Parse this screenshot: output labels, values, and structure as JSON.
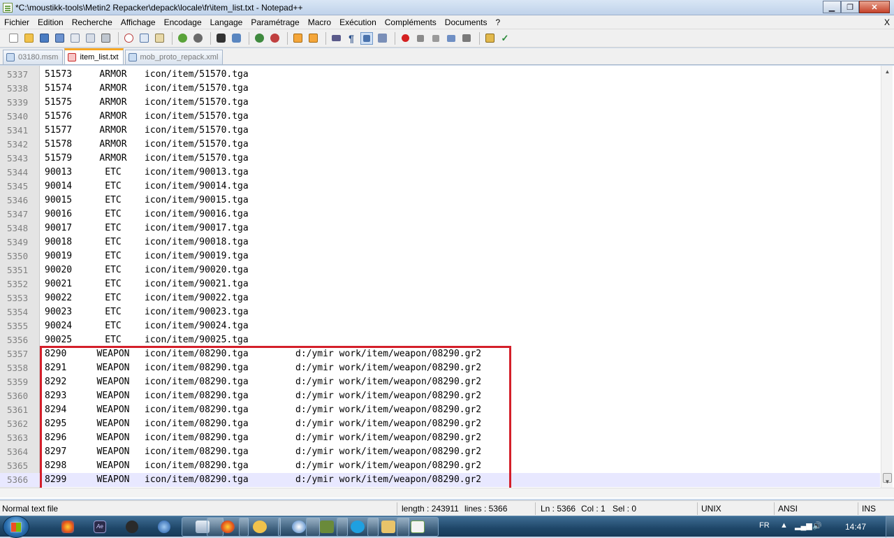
{
  "window": {
    "title": "*C:\\moustikk-tools\\Metin2 Repacker\\depack\\locale\\fr\\item_list.txt - Notepad++"
  },
  "menu": {
    "items": [
      "Fichier",
      "Edition",
      "Recherche",
      "Affichage",
      "Encodage",
      "Langage",
      "Paramétrage",
      "Macro",
      "Exécution",
      "Compléments",
      "Documents",
      "?"
    ],
    "close": "X"
  },
  "toolbar": {
    "buttons": [
      "new-icon",
      "open-icon",
      "save-icon",
      "save-all-icon",
      "close-icon",
      "close-all-icon",
      "print-icon",
      "cut-icon",
      "copy-icon",
      "paste-icon",
      "undo-icon",
      "redo-icon",
      "find-icon",
      "replace-icon",
      "zoom-in-icon",
      "zoom-out-icon",
      "sync-v-icon",
      "sync-h-icon",
      "word-wrap-icon",
      "show-all-chars-icon",
      "indent-guide-icon",
      "user-lang-icon",
      "record-macro-icon",
      "stop-record-icon",
      "play-macro-icon",
      "run-macro-multiple-icon",
      "save-macro-icon",
      "plugin-icon",
      "spell-check-icon"
    ]
  },
  "tabs": [
    {
      "label": "03180.msm",
      "active": false
    },
    {
      "label": "item_list.txt",
      "active": true
    },
    {
      "label": "mob_proto_repack.xml",
      "active": false
    }
  ],
  "editor": {
    "current_line": 5366,
    "lines": [
      {
        "n": "5337",
        "id": "51573",
        "type": "ARMOR",
        "icon": "icon/item/51570.tga",
        "model": ""
      },
      {
        "n": "5338",
        "id": "51574",
        "type": "ARMOR",
        "icon": "icon/item/51570.tga",
        "model": ""
      },
      {
        "n": "5339",
        "id": "51575",
        "type": "ARMOR",
        "icon": "icon/item/51570.tga",
        "model": ""
      },
      {
        "n": "5340",
        "id": "51576",
        "type": "ARMOR",
        "icon": "icon/item/51570.tga",
        "model": ""
      },
      {
        "n": "5341",
        "id": "51577",
        "type": "ARMOR",
        "icon": "icon/item/51570.tga",
        "model": ""
      },
      {
        "n": "5342",
        "id": "51578",
        "type": "ARMOR",
        "icon": "icon/item/51570.tga",
        "model": ""
      },
      {
        "n": "5343",
        "id": "51579",
        "type": "ARMOR",
        "icon": "icon/item/51570.tga",
        "model": ""
      },
      {
        "n": "5344",
        "id": "90013",
        "type": "ETC",
        "icon": "icon/item/90013.tga",
        "model": ""
      },
      {
        "n": "5345",
        "id": "90014",
        "type": "ETC",
        "icon": "icon/item/90014.tga",
        "model": ""
      },
      {
        "n": "5346",
        "id": "90015",
        "type": "ETC",
        "icon": "icon/item/90015.tga",
        "model": ""
      },
      {
        "n": "5347",
        "id": "90016",
        "type": "ETC",
        "icon": "icon/item/90016.tga",
        "model": ""
      },
      {
        "n": "5348",
        "id": "90017",
        "type": "ETC",
        "icon": "icon/item/90017.tga",
        "model": ""
      },
      {
        "n": "5349",
        "id": "90018",
        "type": "ETC",
        "icon": "icon/item/90018.tga",
        "model": ""
      },
      {
        "n": "5350",
        "id": "90019",
        "type": "ETC",
        "icon": "icon/item/90019.tga",
        "model": ""
      },
      {
        "n": "5351",
        "id": "90020",
        "type": "ETC",
        "icon": "icon/item/90020.tga",
        "model": ""
      },
      {
        "n": "5352",
        "id": "90021",
        "type": "ETC",
        "icon": "icon/item/90021.tga",
        "model": ""
      },
      {
        "n": "5353",
        "id": "90022",
        "type": "ETC",
        "icon": "icon/item/90022.tga",
        "model": ""
      },
      {
        "n": "5354",
        "id": "90023",
        "type": "ETC",
        "icon": "icon/item/90023.tga",
        "model": ""
      },
      {
        "n": "5355",
        "id": "90024",
        "type": "ETC",
        "icon": "icon/item/90024.tga",
        "model": ""
      },
      {
        "n": "5356",
        "id": "90025",
        "type": "ETC",
        "icon": "icon/item/90025.tga",
        "model": ""
      },
      {
        "n": "5357",
        "id": "8290",
        "type": "WEAPON",
        "icon": "icon/item/08290.tga",
        "model": "d:/ymir work/item/weapon/08290.gr2"
      },
      {
        "n": "5358",
        "id": "8291",
        "type": "WEAPON",
        "icon": "icon/item/08290.tga",
        "model": "d:/ymir work/item/weapon/08290.gr2"
      },
      {
        "n": "5359",
        "id": "8292",
        "type": "WEAPON",
        "icon": "icon/item/08290.tga",
        "model": "d:/ymir work/item/weapon/08290.gr2"
      },
      {
        "n": "5360",
        "id": "8293",
        "type": "WEAPON",
        "icon": "icon/item/08290.tga",
        "model": "d:/ymir work/item/weapon/08290.gr2"
      },
      {
        "n": "5361",
        "id": "8294",
        "type": "WEAPON",
        "icon": "icon/item/08290.tga",
        "model": "d:/ymir work/item/weapon/08290.gr2"
      },
      {
        "n": "5362",
        "id": "8295",
        "type": "WEAPON",
        "icon": "icon/item/08290.tga",
        "model": "d:/ymir work/item/weapon/08290.gr2"
      },
      {
        "n": "5363",
        "id": "8296",
        "type": "WEAPON",
        "icon": "icon/item/08290.tga",
        "model": "d:/ymir work/item/weapon/08290.gr2"
      },
      {
        "n": "5364",
        "id": "8297",
        "type": "WEAPON",
        "icon": "icon/item/08290.tga",
        "model": "d:/ymir work/item/weapon/08290.gr2"
      },
      {
        "n": "5365",
        "id": "8298",
        "type": "WEAPON",
        "icon": "icon/item/08290.tga",
        "model": "d:/ymir work/item/weapon/08290.gr2"
      },
      {
        "n": "5366",
        "id": "8299",
        "type": "WEAPON",
        "icon": "icon/item/08290.tga",
        "model": "d:/ymir work/item/weapon/08290.gr2"
      }
    ],
    "highlight_color": "#d41f2a"
  },
  "status": {
    "file_type": "Normal text file",
    "length": "length : 243911",
    "lines": "lines : 5366",
    "ln": "Ln : 5366",
    "col": "Col : 1",
    "sel": "Sel : 0",
    "eol": "UNIX",
    "encoding": "ANSI",
    "mode": "INS"
  },
  "taskbar": {
    "language": "FR",
    "clock": "14:47"
  }
}
